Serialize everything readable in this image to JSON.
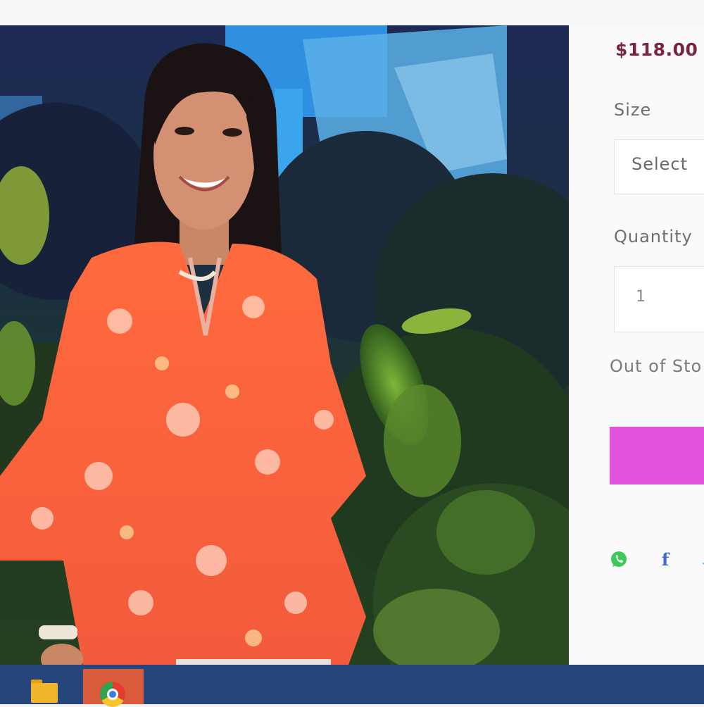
{
  "product": {
    "price": "$118.00",
    "size_label": "Size",
    "size_select_value": "Select",
    "quantity_label": "Quantity",
    "quantity_value": "1",
    "stock_status": "Out of Sto",
    "add_to_cart_color": "#e152de"
  },
  "share_icons": [
    "whatsapp-icon",
    "facebook-icon",
    "twitter-icon"
  ],
  "share_glyphs": {
    "facebook": "f"
  },
  "taskbar": {
    "pinned": [
      "file-explorer-icon",
      "chrome-icon"
    ]
  },
  "colors": {
    "price": "#7a2343",
    "taskbar": "#26457a",
    "accent": "#e152de"
  }
}
